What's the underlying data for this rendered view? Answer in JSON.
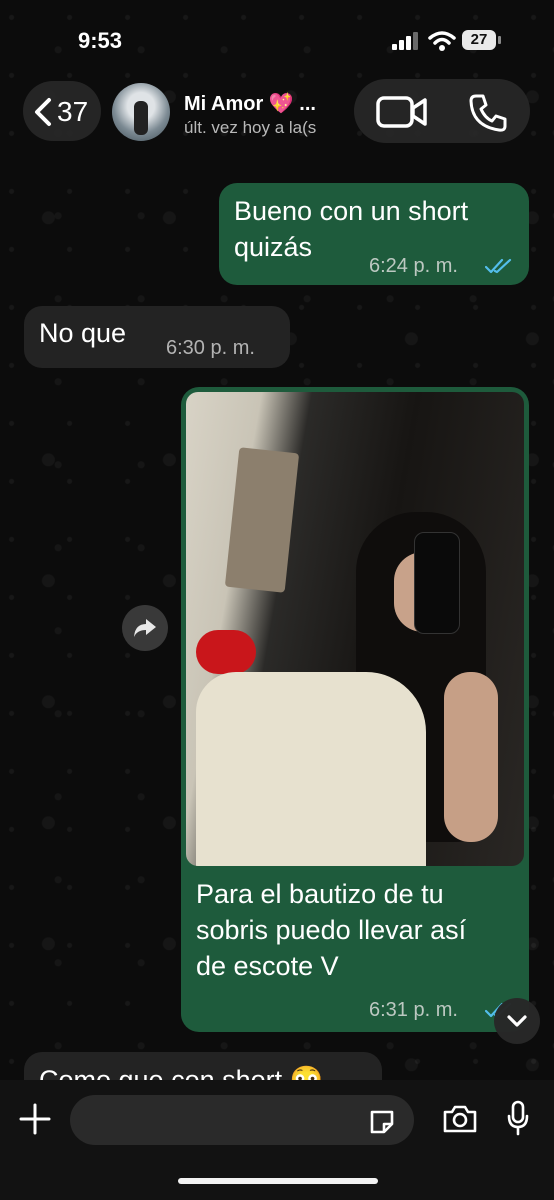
{
  "status_bar": {
    "time": "9:53",
    "battery_level": "27"
  },
  "header": {
    "back_count": "37",
    "contact_name": "Mi Amor 💖 ...",
    "contact_status": "últ. vez hoy a la(s"
  },
  "messages": [
    {
      "direction": "outgoing",
      "text_line1": "Bueno con un short",
      "text_line2": "quizás",
      "time": "6:24 p. m.",
      "read": true
    },
    {
      "direction": "incoming",
      "text": "No que",
      "time": "6:30 p. m."
    },
    {
      "direction": "outgoing",
      "type": "image",
      "caption_line1": "Para el bautizo de tu",
      "caption_line2": "sobris puedo llevar así",
      "caption_line3": "de escote V",
      "time": "6:31 p. m.",
      "read": true
    },
    {
      "direction": "incoming",
      "text": "Como que con short 😳"
    }
  ],
  "input_bar": {
    "placeholder": ""
  },
  "colors": {
    "outgoing_bubble": "#1e5b3c",
    "incoming_bubble": "#232323",
    "read_ticks": "#53bdeb",
    "background": "#0b0b0b"
  }
}
